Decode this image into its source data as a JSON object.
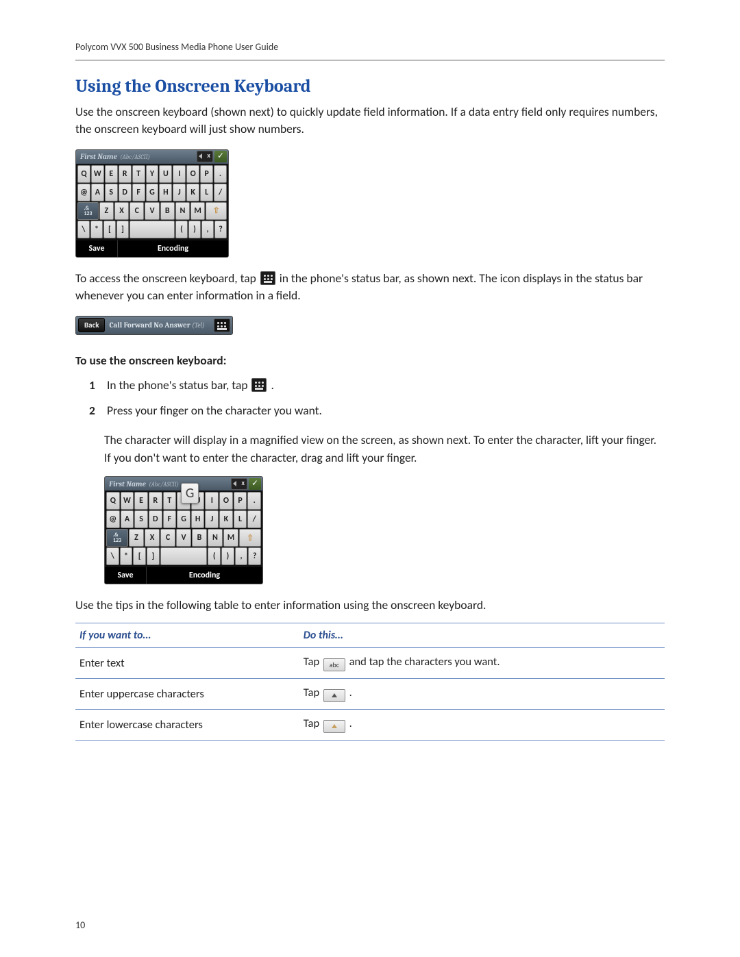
{
  "header": {
    "running": "Polycom VVX 500 Business Media Phone User Guide"
  },
  "section": {
    "title": "Using the Onscreen Keyboard",
    "intro": "Use the onscreen keyboard (shown next) to quickly update field information. If a data entry field only requires numbers, the onscreen keyboard will just show numbers.",
    "access_before": "To access the onscreen keyboard, tap ",
    "access_after": " in the phone's status bar, as shown next. The icon displays in the status bar whenever you can enter information in a field.",
    "howto_head": "To use the onscreen keyboard:",
    "step1_before": "In the phone's status bar, tap ",
    "step1_after": " .",
    "step2": "Press your finger on the character you want.",
    "step2_sub": "The character will display in a magnified view on the screen, as shown next. To enter the character, lift your finger. If you don't want to enter the character, drag and lift your finger.",
    "tips_lead": "Use the tips in the following table to enter information using the onscreen keyboard."
  },
  "keyboard": {
    "field_label": "First Name",
    "field_mode": "(Abc/ASCII)",
    "ok_mark": "✓",
    "rows": {
      "r1": [
        "Q",
        "W",
        "E",
        "R",
        "T",
        "Y",
        "U",
        "I",
        "O",
        "P",
        "."
      ],
      "r2": [
        "@",
        "A",
        "S",
        "D",
        "F",
        "G",
        "H",
        "J",
        "K",
        "L",
        "/"
      ],
      "r3_mode": ".&\n123",
      "r3": [
        "Z",
        "X",
        "C",
        "V",
        "B",
        "N",
        "M"
      ],
      "r3_shift": "⇧",
      "r4": [
        "\\",
        "*",
        "[",
        "]"
      ],
      "r4b": [
        "(",
        ")",
        ",",
        "?"
      ]
    },
    "save": "Save",
    "encoding": "Encoding",
    "pop_key": "G"
  },
  "statusbar": {
    "back": "Back",
    "title": "Call Forward No Answer",
    "sub": "(Tel)"
  },
  "table": {
    "head_left": "If you want to…",
    "head_right": "Do this…",
    "rows": [
      {
        "left": "Enter text",
        "tap": "Tap ",
        "key": "abc",
        "after": " and tap the characters you want."
      },
      {
        "left": "Enter uppercase characters",
        "tap": "Tap ",
        "keyicon": "shift-up",
        "after": " ."
      },
      {
        "left": "Enter lowercase characters",
        "tap": "Tap ",
        "keyicon": "shift-down",
        "after": " ."
      }
    ]
  },
  "page_number": "10"
}
